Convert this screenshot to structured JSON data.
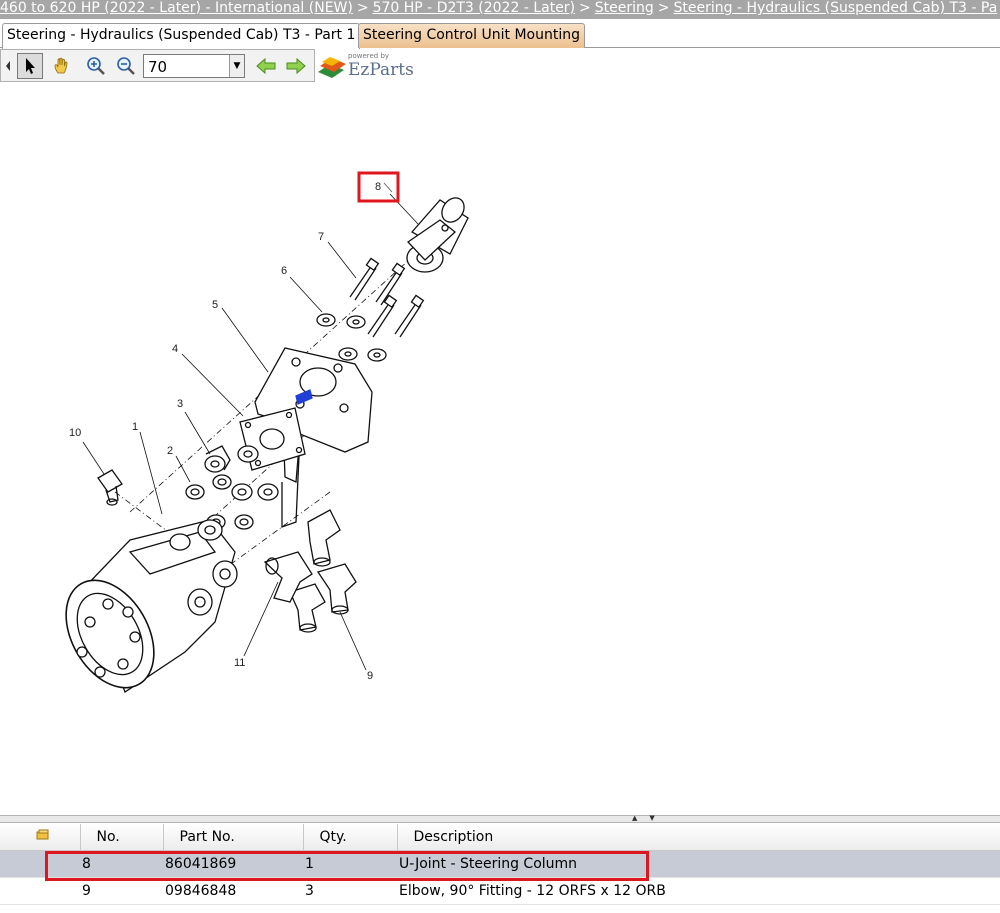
{
  "breadcrumb": {
    "items": [
      {
        "label": "460 to 620 HP (2022 - Later) - International (NEW)"
      },
      {
        "label": "570 HP - D2T3 (2022 - Later)"
      },
      {
        "label": "Steering"
      },
      {
        "label": "Steering - Hydraulics (Suspended Cab) T3 - Pa"
      }
    ],
    "separator": ">"
  },
  "tabs": [
    {
      "label": "Steering - Hydraulics (Suspended Cab) T3 - Part 1",
      "active": true
    },
    {
      "label": "Steering Control Unit Mounting",
      "active": false
    }
  ],
  "toolbar": {
    "zoom_value": "70",
    "tools": [
      "select-arrow-icon",
      "pan-hand-icon",
      "zoom-in-icon",
      "zoom-out-icon",
      "back-arrow-icon",
      "forward-arrow-icon"
    ],
    "logo": {
      "powered_by": "powered by",
      "name": "EzParts"
    }
  },
  "diagram": {
    "callouts": [
      "1",
      "2",
      "3",
      "4",
      "5",
      "6",
      "7",
      "8",
      "9",
      "10",
      "11"
    ],
    "selected_callout": "8",
    "highlight_color": "#e0161e"
  },
  "table": {
    "columns": [
      "No.",
      "Part No.",
      "Qty.",
      "Description"
    ],
    "rows": [
      {
        "no": "8",
        "part_no": "86041869",
        "qty": "1",
        "description": "U-Joint - Steering Column",
        "selected": true
      },
      {
        "no": "9",
        "part_no": "09846848",
        "qty": "3",
        "description": "Elbow, 90° Fitting - 12 ORFS x 12 ORB",
        "selected": false
      }
    ]
  }
}
